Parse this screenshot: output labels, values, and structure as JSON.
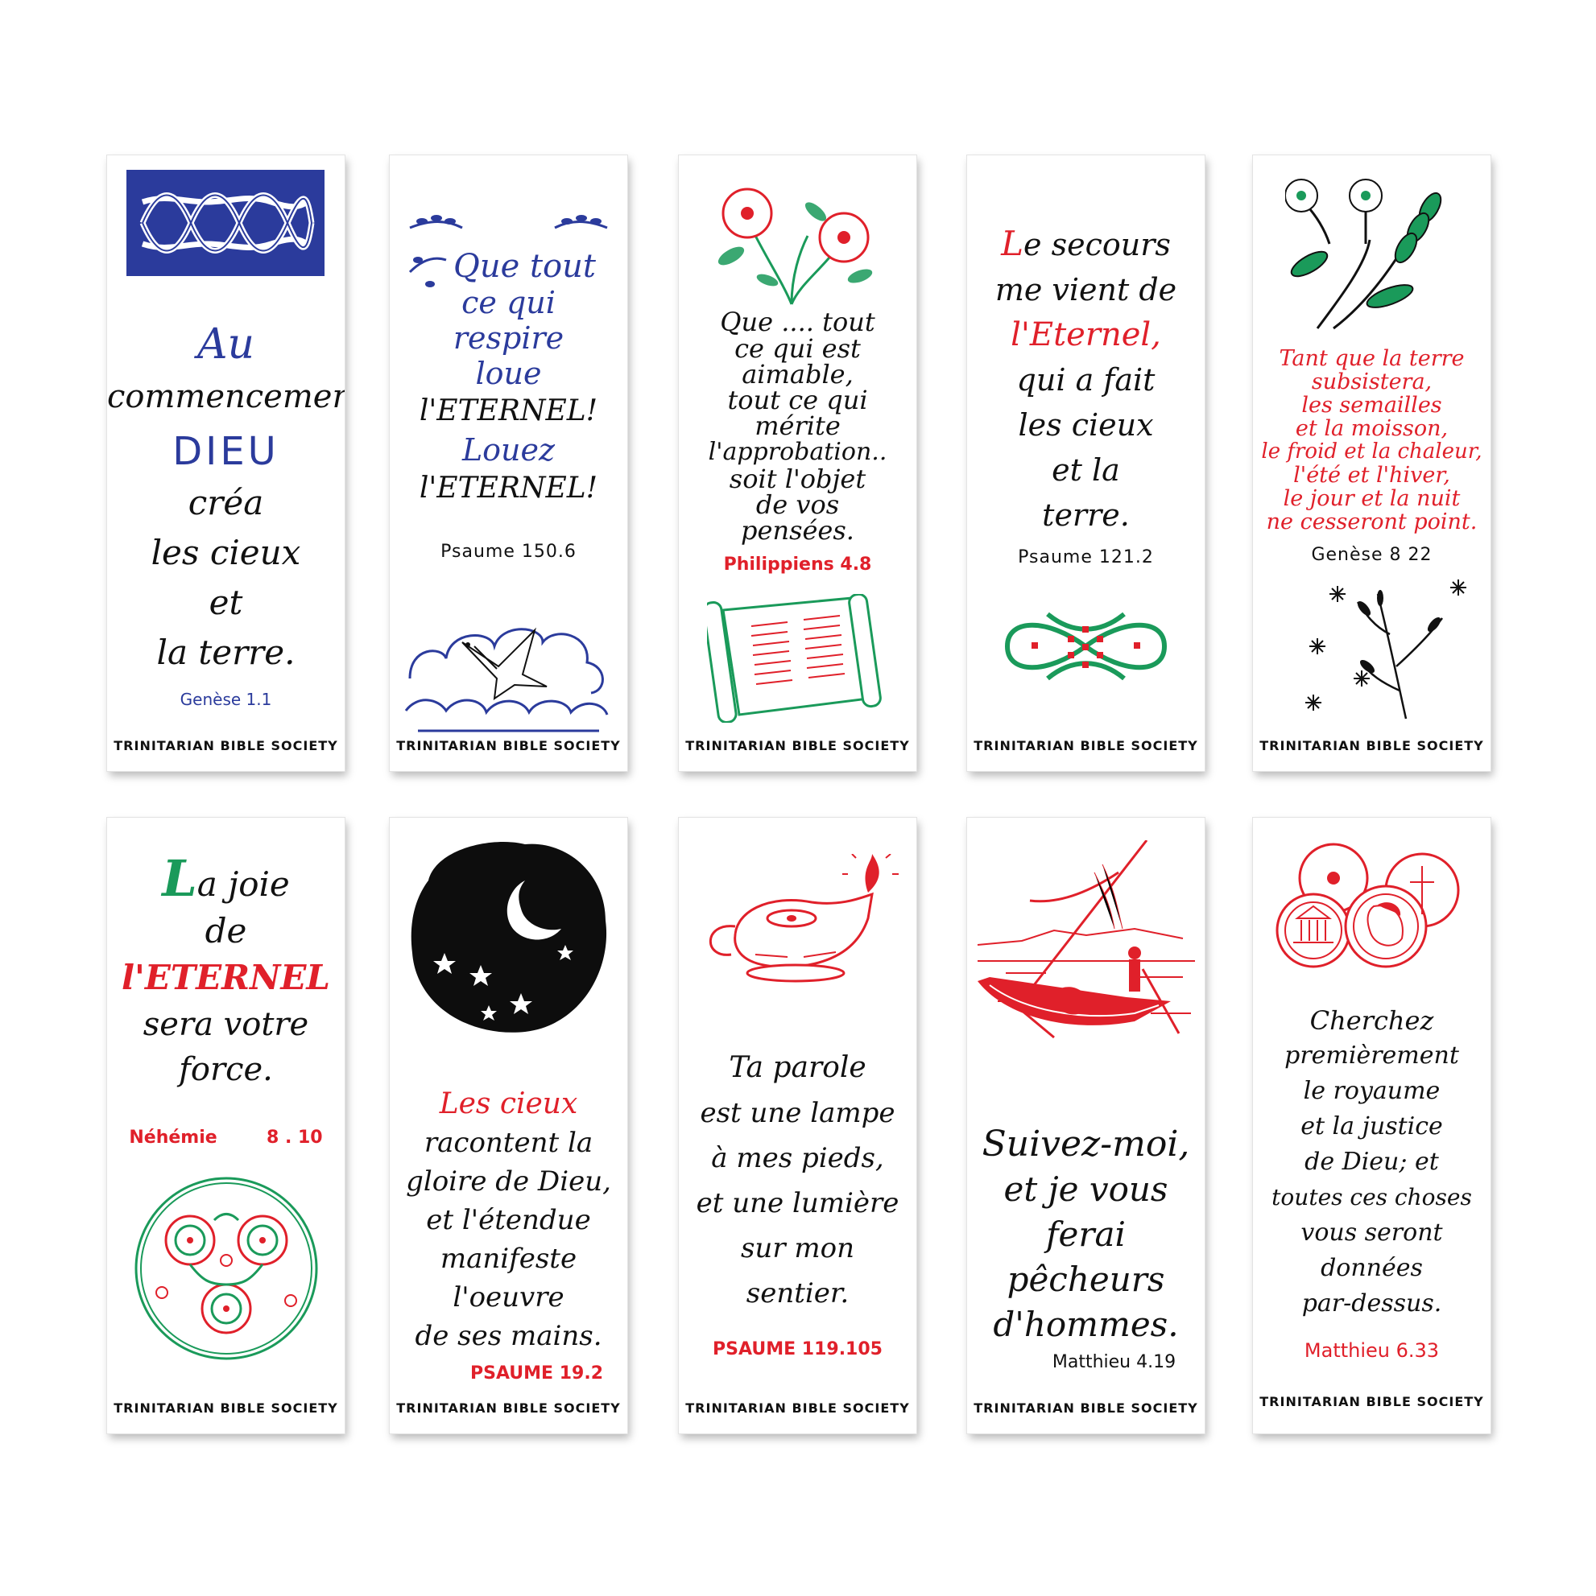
{
  "colors": {
    "blue": "#2b3b9c",
    "red": "#e0202a",
    "green": "#1a9a5a",
    "black": "#111111"
  },
  "society": "TRINITARIAN BIBLE SOCIETY",
  "cards": [
    {
      "icon": "celtic-knot-icon",
      "lines": [
        "Au",
        "commencement,",
        "DIEU",
        "créa",
        "les cieux",
        "et",
        "la terre."
      ],
      "ref": "Genèse 1.1"
    },
    {
      "icon": "dove-clouds-icon",
      "lines": [
        "Que tout",
        "ce qui",
        "respire",
        "loue",
        "l'ETERNEL!",
        "Louez",
        "l'ETERNEL!"
      ],
      "ref": "Psaume 150.6"
    },
    {
      "icon": "flower-scroll-icon",
      "lines": [
        "Que .... tout",
        "ce qui est",
        "aimable,",
        "tout ce qui",
        "mérite",
        "l'approbation..",
        "soit l'objet",
        "de vos",
        "pensées."
      ],
      "ref": "Philippiens 4.8"
    },
    {
      "icon": "knot-ornament-icon",
      "lines": [
        "Le secours",
        "me vient de",
        "l'Eternel,",
        "qui a fait",
        "les cieux",
        "et la",
        "terre."
      ],
      "ref": "Psaume 121.2"
    },
    {
      "icon": "flower-wheat-icon",
      "lines": [
        "Tant que la terre",
        "subsistera,",
        "les semailles",
        "et la moisson,",
        "le froid et la chaleur,",
        "l'été et l'hiver,",
        "le jour et la nuit",
        "ne cesseront point."
      ],
      "ref": "Genèse 8 22"
    },
    {
      "icon": "triskele-circle-icon",
      "lines": [
        "La joie",
        "de",
        "l'ETERNEL",
        "sera votre",
        "force."
      ],
      "ref_book": "Néhémie",
      "ref_num": "8 . 10"
    },
    {
      "icon": "moon-stars-icon",
      "lines": [
        "Les cieux",
        "racontent la",
        "gloire de Dieu,",
        "et l'étendue",
        "manifeste",
        "l'oeuvre",
        "de ses mains."
      ],
      "ref": "PSAUME 19.2"
    },
    {
      "icon": "oil-lamp-icon",
      "lines": [
        "Ta parole",
        "est une lampe",
        "à mes pieds,",
        "et une lumière",
        "sur mon",
        "sentier."
      ],
      "ref": "PSAUME 119.105"
    },
    {
      "icon": "fishing-boat-icon",
      "lines": [
        "Suivez-moi,",
        "et je vous",
        "ferai",
        "pêcheurs",
        "d'hommes."
      ],
      "ref": "Matthieu 4.19"
    },
    {
      "icon": "coins-icon",
      "lines": [
        "Cherchez",
        "premièrement",
        "le royaume",
        "et la justice",
        "de Dieu; et",
        "toutes ces choses",
        "vous seront",
        "données",
        "par-dessus."
      ],
      "ref": "Matthieu 6.33"
    }
  ]
}
